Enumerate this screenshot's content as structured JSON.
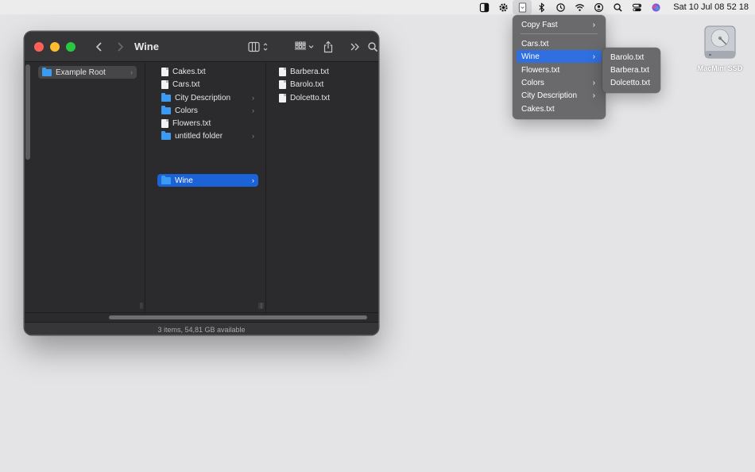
{
  "menubar": {
    "icons": [
      "half-square-icon",
      "gear-icon",
      "copyfast-icon",
      "bluetooth-icon",
      "time-machine-icon",
      "wifi-icon",
      "user-icon",
      "spotlight-icon",
      "control-center-icon",
      "siri-icon"
    ],
    "clock": "Sat 10 Jul  08 52 18"
  },
  "window": {
    "title": "Wine",
    "status": "3 items, 54,81 GB available",
    "columns": [
      {
        "items": [
          {
            "label": "Example Root",
            "kind": "folder",
            "has_children": true,
            "state": "dimsel"
          }
        ]
      },
      {
        "items": [
          {
            "label": "Cakes.txt",
            "kind": "file"
          },
          {
            "label": "Cars.txt",
            "kind": "file"
          },
          {
            "label": "City Description",
            "kind": "folder",
            "has_children": true
          },
          {
            "label": "Colors",
            "kind": "folder",
            "has_children": true
          },
          {
            "label": "Flowers.txt",
            "kind": "file"
          },
          {
            "label": "untitled folder",
            "kind": "folder",
            "has_children": true
          },
          {
            "label": "Wine",
            "kind": "folder",
            "has_children": true,
            "state": "selected"
          }
        ]
      },
      {
        "items": [
          {
            "label": "Barbera.txt",
            "kind": "file"
          },
          {
            "label": "Barolo.txt",
            "kind": "file"
          },
          {
            "label": "Dolcetto.txt",
            "kind": "file"
          }
        ]
      }
    ]
  },
  "menu": {
    "header": "Copy Fast",
    "items": [
      {
        "label": "Cars.txt",
        "submenu": false
      },
      {
        "label": "Wine",
        "submenu": true,
        "highlighted": true
      },
      {
        "label": "Flowers.txt",
        "submenu": false
      },
      {
        "label": "Colors",
        "submenu": true
      },
      {
        "label": "City Description",
        "submenu": true
      },
      {
        "label": "Cakes.txt",
        "submenu": false
      }
    ],
    "submenu": [
      "Barolo.txt",
      "Barbera.txt",
      "Dolcetto.txt"
    ]
  },
  "desktop": {
    "disk_label": "MacMini SSD"
  },
  "colors": {
    "accent": "#2f6fe0",
    "selection": "#1d63d8",
    "folder": "#3b9bf0"
  }
}
